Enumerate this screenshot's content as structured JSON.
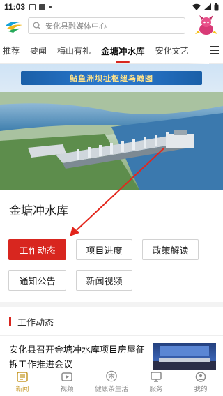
{
  "status": {
    "time": "11:03"
  },
  "search": {
    "placeholder": "安化县融媒体中心"
  },
  "tabs": [
    {
      "label": "推荐"
    },
    {
      "label": "要闻"
    },
    {
      "label": "梅山有礼"
    },
    {
      "label": "金塘冲水库"
    },
    {
      "label": "安化文艺"
    }
  ],
  "banner": {
    "title": "鲇鱼洲坝址枢纽鸟瞰图"
  },
  "page": {
    "title": "金塘冲水库"
  },
  "grid": [
    {
      "label": "工作动态"
    },
    {
      "label": "项目进度"
    },
    {
      "label": "政策解读"
    },
    {
      "label": "通知公告"
    },
    {
      "label": "新闻视频"
    }
  ],
  "section": {
    "title": "工作动态"
  },
  "news": [
    {
      "title": "安化县召开金塘冲水库项目房屋征拆工作推进会议"
    }
  ],
  "bottom_nav": [
    {
      "label": "新闻",
      "icon": "news-icon"
    },
    {
      "label": "视频",
      "icon": "video-icon"
    },
    {
      "label": "健康茶生活",
      "icon": "tea-icon"
    },
    {
      "label": "服务",
      "icon": "service-icon"
    },
    {
      "label": "我的",
      "icon": "profile-icon"
    }
  ],
  "colors": {
    "accent": "#d8261f",
    "nav_active": "#c79a2a"
  }
}
